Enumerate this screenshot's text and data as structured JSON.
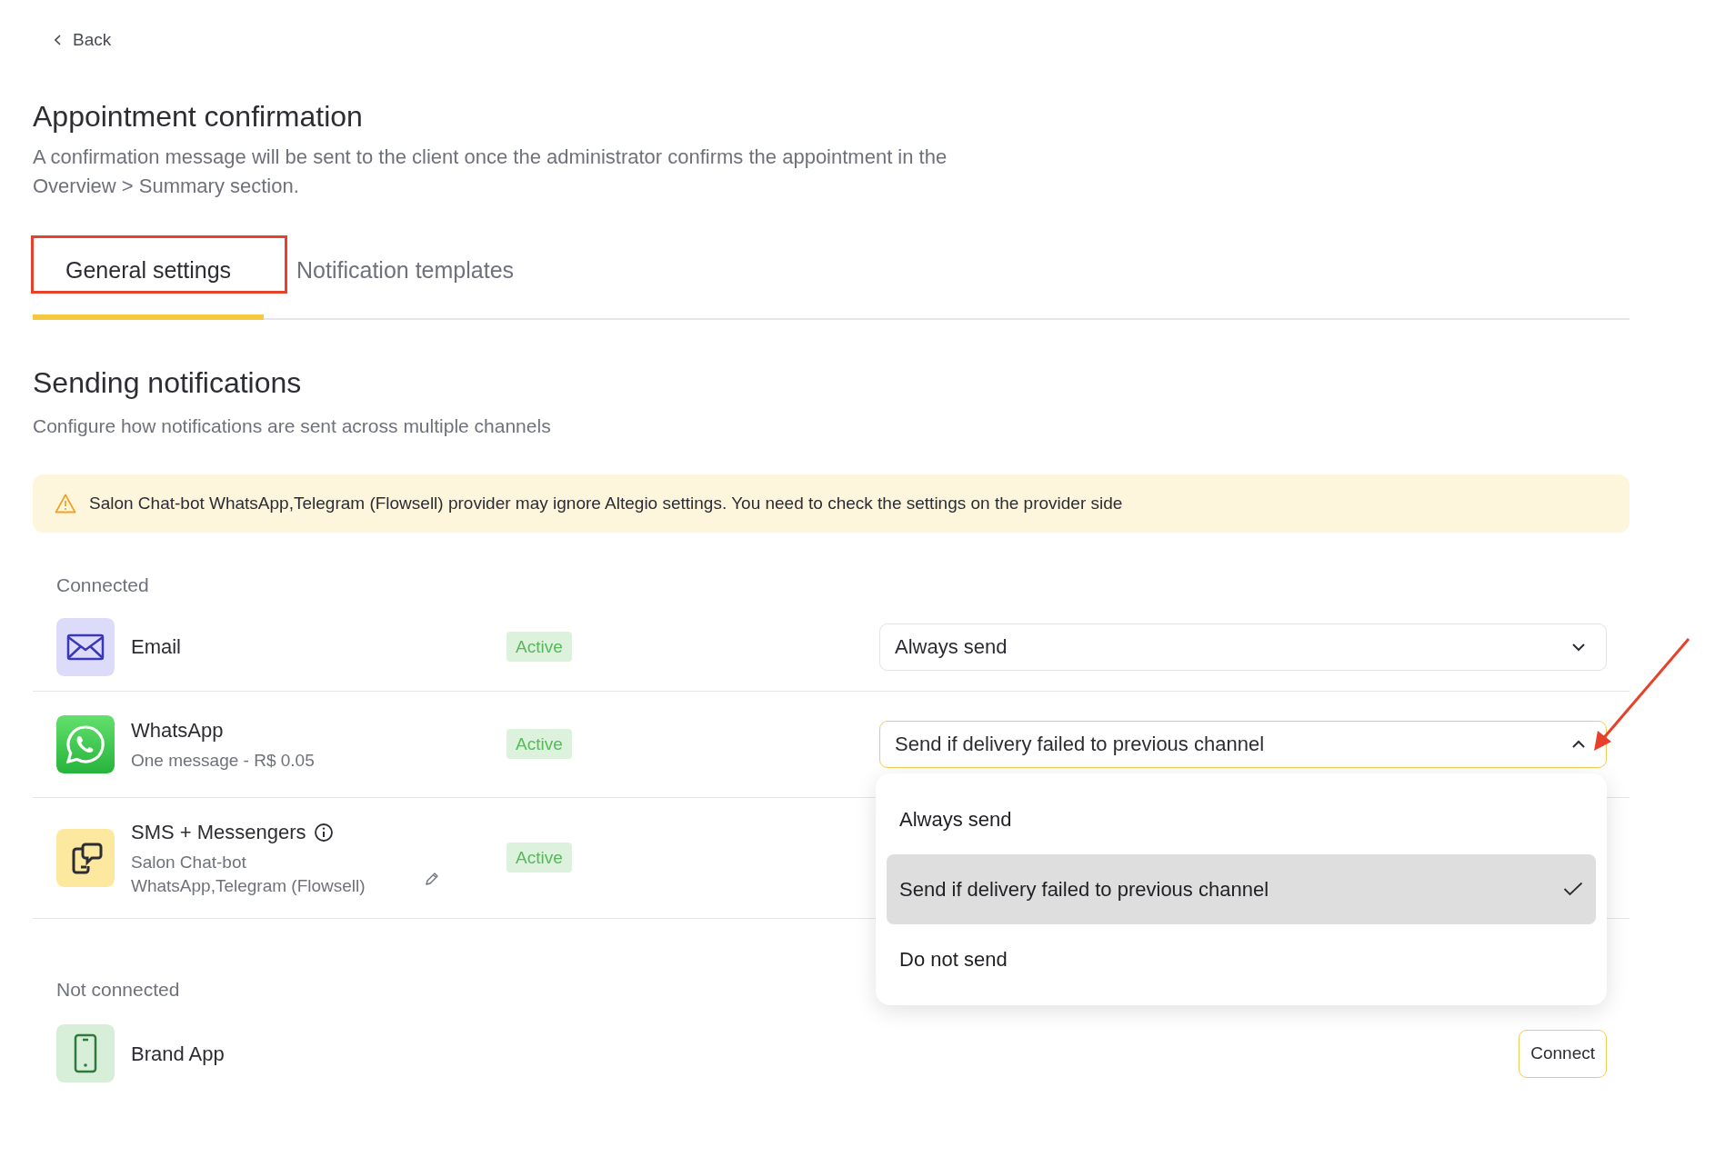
{
  "back": {
    "label": "Back"
  },
  "title": "Appointment confirmation",
  "description": "A confirmation message will be sent to the client once the administrator confirms the appointment in the Overview > Summary section.",
  "tabs": [
    {
      "label": "General settings",
      "selected": true
    },
    {
      "label": "Notification templates",
      "selected": false
    }
  ],
  "section": {
    "title": "Sending notifications",
    "subtitle": "Configure how notifications are sent across multiple channels"
  },
  "alert": {
    "text": "Salon Chat-bot WhatsApp,Telegram (Flowsell) provider may ignore Altegio settings. You need to check the settings on the provider side"
  },
  "groups": [
    {
      "label": "Connected",
      "channels": [
        {
          "kind": "email",
          "name": "Email",
          "status": "Active",
          "select": {
            "value": "Always send",
            "expanded": false
          }
        },
        {
          "kind": "whatsapp",
          "name": "WhatsApp",
          "subtitle_lines": [
            "One message - R$ 0.05"
          ],
          "status": "Active",
          "select": {
            "value": "Send if delivery failed to previous channel",
            "expanded": true,
            "options": [
              {
                "label": "Always send",
                "selected": false
              },
              {
                "label": "Send if delivery failed to previous channel",
                "selected": true
              },
              {
                "label": "Do not send",
                "selected": false
              }
            ]
          }
        },
        {
          "kind": "sms",
          "name": "SMS + Messengers",
          "info": true,
          "editable": true,
          "subtitle_lines": [
            "Salon Chat-bot",
            "WhatsApp,Telegram (Flowsell)"
          ],
          "status": "Active"
        }
      ]
    },
    {
      "label": "Not connected",
      "channels": [
        {
          "kind": "app",
          "name": "Brand App",
          "action": "Connect"
        }
      ]
    }
  ]
}
